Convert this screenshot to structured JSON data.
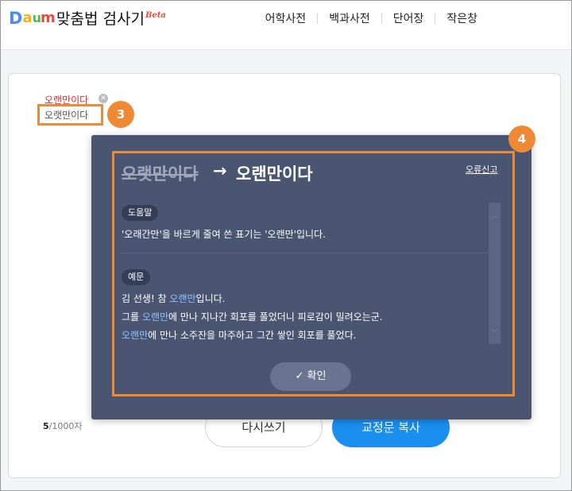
{
  "header": {
    "logo": {
      "letters": [
        "D",
        "a",
        "u",
        "m"
      ],
      "colors": [
        "#4a8cf2",
        "#f2b313",
        "#4bbb53",
        "#e84a3c"
      ]
    },
    "title": "맞춤법 검사기",
    "beta": "Beta",
    "nav": [
      {
        "label": "어학사전"
      },
      {
        "label": "백과사전"
      },
      {
        "label": "단어장"
      },
      {
        "label": "작은창"
      }
    ]
  },
  "editor": {
    "error_word": "오랜만이다",
    "input_word": "오랫만이다",
    "counter_current": "5",
    "counter_max": "/1000자"
  },
  "markers": {
    "m3": "3",
    "m4": "4"
  },
  "popup": {
    "wrong": "오랫만이다",
    "arrow": "→",
    "right": "오랜만이다",
    "report": "오류신고",
    "help_tag": "도움말",
    "help_text": "'오래간만'을 바르게 줄여 쓴 표기는 '오랜만'입니다.",
    "example_tag": "예문",
    "examples": [
      {
        "pre": "김 선생! 참 ",
        "hl": "오랜만",
        "post": "입니다."
      },
      {
        "pre": "그를 ",
        "hl": "오랜만",
        "post": "에 만나 지나간 회포를 풀었더니 피로감이 밀려오는군."
      },
      {
        "pre": "",
        "hl": "오랜만",
        "post": "에 만나 소주잔을 마주하고 그간 쌓인 회포를 풀었다."
      }
    ],
    "confirm": "✓ 확인"
  },
  "buttons": {
    "reset": "다시쓰기",
    "copy": "교정문 복사"
  },
  "colors": {
    "accent_orange": "#ee8a35",
    "primary_blue": "#1a8ff0",
    "popup_bg": "#4a5572",
    "error_red": "#e0262f"
  }
}
